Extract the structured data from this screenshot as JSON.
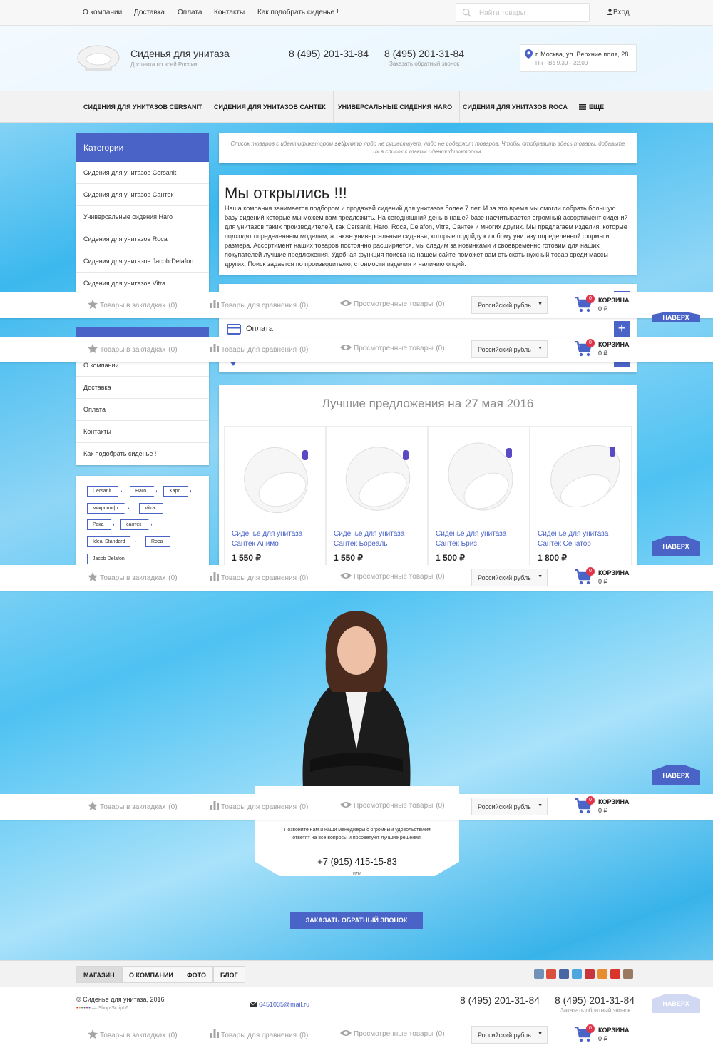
{
  "topnav": {
    "items": [
      "О компании",
      "Доставка",
      "Оплата",
      "Контакты",
      "Как подобрать сиденье !"
    ],
    "search_placeholder": "Найти товары",
    "login": "Вход"
  },
  "header": {
    "site_name": "Сиденья для унитаза",
    "site_sub": "Доставка по всей России",
    "phone1": "8 (495) 201-31-84",
    "phone2": "8 (495) 201-31-84",
    "callback": "Заказать обратный звонок",
    "address": "г. Москва, ул. Верхние поля, 28",
    "hours": "Пн—Вс 9.30—22.00"
  },
  "catnav": {
    "items": [
      "Сидения для унитазов Cersanit",
      "Сидения для унитазов Сантек",
      "Универсальные сидения Haro",
      "Сидения для унитазов Roca"
    ],
    "more": "Еще"
  },
  "sidebar": {
    "title": "Категории",
    "categories": [
      "Сидения для унитазов Cersanit",
      "Сидения для унитазов Сантек",
      "Универсальные сидения Haro",
      "Сидения для унитазов Roca",
      "Сидения для унитазов Jacob Delafon",
      "Сидения для унитазов Vitra"
    ],
    "pages": [
      "О компании",
      "Доставка",
      "Оплата",
      "Контакты",
      "Как подобрать сиденье !"
    ],
    "tags": [
      "Cersanit",
      "Haro",
      "Харо",
      "микролифт",
      "Vitra",
      "Рока",
      "сантек",
      "Ideal Standard",
      "Roca",
      "Jacob Delafon"
    ]
  },
  "notice": {
    "pre": "Список товаров с идентификатором ",
    "id": "set/promo",
    "post": " либо не существует, либо не содержит товаров. Чтобы отобразить здесь товары, добавьте их в список с таким идентификатором."
  },
  "welcome": {
    "title": "Мы открылись !!!",
    "text": "Наша компания занимается подбором и продажей сидений для унитазов более 7 лет. И за это время мы смогли собрать большую базу сидений которые мы можем вам предложить. На сегодняшний день в нашей базе насчитывается огромный ассортимент сидений для унитазов таких производителей, как Cersanit, Haro, Roca, Delafon, Vitra, Сантек и многих других. Мы предлагаем изделия, которые подходят определенным моделям, а также универсальные сиденья, которые подойду к любому унитазу определенной формы и размера. Ассортимент наших товаров постоянно расширяется, мы следим за новинками и своевременно готовим для наших покупателей лучшие предложения. Удобная функция поиска на нашем сайте поможет вам отыскать нужный товар среди массы других. Поиск задается по производителю, стоимости изделия и наличию опций."
  },
  "payment": {
    "label": "Оплата"
  },
  "best": {
    "title": "Лучшие предложения на 27 мая 2016",
    "products": [
      {
        "name": "Сиденье для унитаза Сантек Анимо",
        "price": "1 550 ₽"
      },
      {
        "name": "Сиденье для унитаза Сантек Бореаль",
        "price": "1 550 ₽"
      },
      {
        "name": "Сиденье для унитаза Сантек Бриз",
        "price": "1 500 ₽"
      },
      {
        "name": "Сиденье для унитаза Сантек Сенатор",
        "price": "1 800 ₽"
      }
    ]
  },
  "sticky": {
    "bookmarks": "Товары в закладках",
    "bookmarks_count": "(0)",
    "compare": "Товары для сравнения",
    "compare_count": "(0)",
    "viewed": "Просмотренные товары",
    "viewed_count": "(0)",
    "currency": "Российский рубль",
    "cart_title": "КОРЗИНА",
    "cart_sum": "0 ₽",
    "cart_count": "0",
    "up": "НАВЕРХ"
  },
  "callback_block": {
    "text": "Позвоните нам и наши менеджеры с огромным удовольствием ответят на все вопросы и посоветуют лучшие решения.",
    "phone": "+7 (915) 415-15-83",
    "or": "или",
    "button": "ЗАКАЗАТЬ ОБРАТНЫЙ ЗВОНОК"
  },
  "footer": {
    "tabs": [
      "МАГАЗИН",
      "О КОМПАНИИ",
      "ФОТО",
      "БЛОГ"
    ],
    "copyright": "© Сиденье для унитаза, 2016",
    "powered": "— Shop-Script 6",
    "email": "6451035@mail.ru",
    "phone1": "8 (495) 201-31-84",
    "phone2": "8 (495) 201-31-84",
    "callback": "Заказать обратный звонок"
  },
  "colors": {
    "accent": "#4a63c6",
    "badge": "#e0344b"
  }
}
